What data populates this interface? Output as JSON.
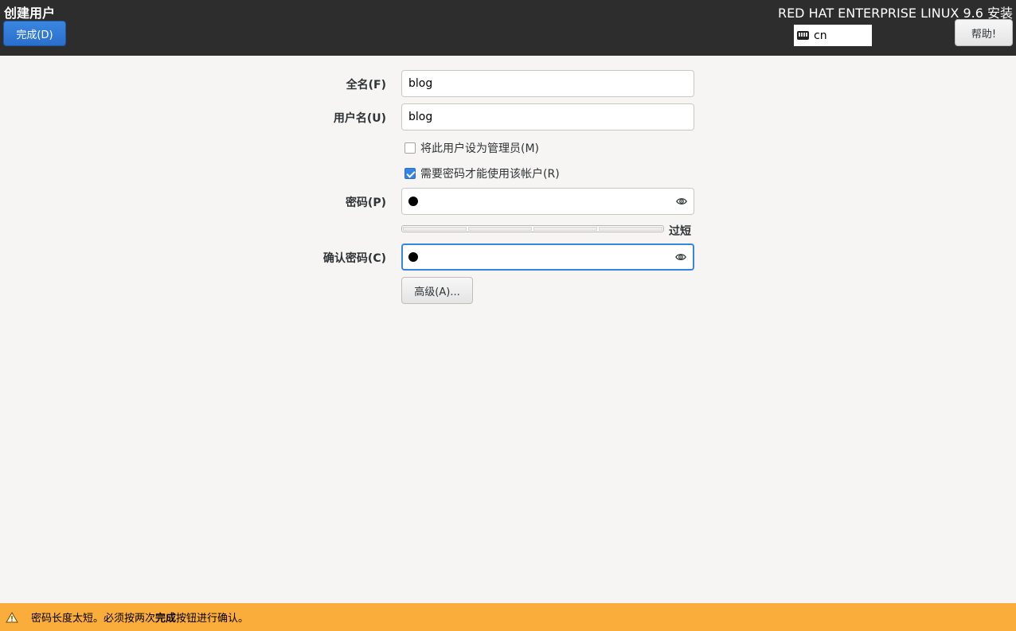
{
  "header": {
    "title": "创建用户",
    "done_label": "完成(D)",
    "product": "RED HAT ENTERPRISE LINUX 9.6 安装",
    "keyboard_layout": "cn",
    "help_label": "帮助!"
  },
  "form": {
    "fullname_label": "全名(F)",
    "fullname_value": "blog",
    "username_label": "用户名(U)",
    "username_value": "blog",
    "admin_checkbox_label": "将此用户设为管理员(M)",
    "admin_checked": false,
    "require_password_label": "需要密码才能使用该帐户(R)",
    "require_password_checked": true,
    "password_label": "密码(P)",
    "password_strength": "过短",
    "confirm_label": "确认密码(C)",
    "advanced_label": "高级(A)..."
  },
  "warning": {
    "text_before": "密码长度太短。必须按两次",
    "text_bold": "完成",
    "text_after": "按钮进行确认。"
  },
  "colors": {
    "header_bg": "#2d2d2d",
    "accent": "#3584e4",
    "warning_bg": "#fbad3b"
  }
}
